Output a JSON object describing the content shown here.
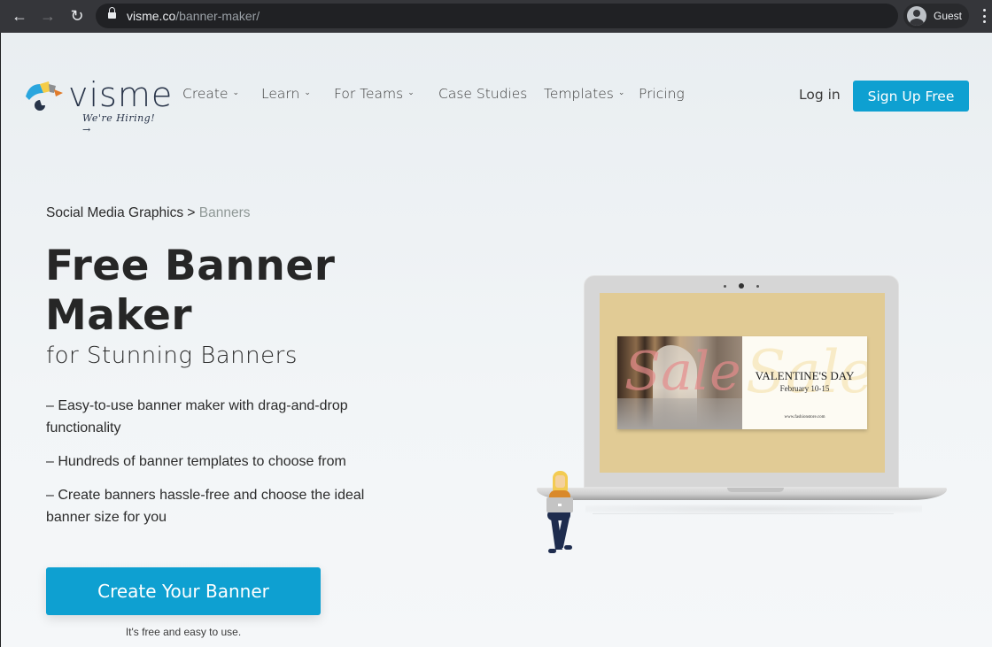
{
  "browser": {
    "url_host": "visme.co",
    "url_path": "/banner-maker/",
    "profile_name": "Guest",
    "icons": [
      "back-arrow-icon",
      "forward-arrow-icon",
      "reload-icon",
      "lock-icon",
      "profile-avatar-icon",
      "kebab-menu-icon"
    ]
  },
  "header": {
    "logo_text": "visme",
    "hiring_text": "We're Hiring! →",
    "nav": [
      {
        "label": "Create",
        "has_dropdown": true
      },
      {
        "label": "Learn",
        "has_dropdown": true
      },
      {
        "label": "For Teams",
        "has_dropdown": true
      },
      {
        "label": "Case Studies",
        "has_dropdown": false
      },
      {
        "label": "Templates",
        "has_dropdown": true
      },
      {
        "label": "Pricing",
        "has_dropdown": false
      }
    ],
    "chevron": "⌄",
    "login_label": "Log in",
    "signup_label": "Sign Up Free"
  },
  "hero": {
    "breadcrumb": {
      "parent": "Social Media Graphics",
      "separator": " > ",
      "current": "Banners"
    },
    "title": "Free Banner Maker",
    "subtitle": "for Stunning Banners",
    "features": [
      "– Easy-to-use banner maker with drag-and-drop functionality",
      "– Hundreds of banner templates to choose from",
      "– Create banners hassle-free and choose the ideal banner size for you"
    ],
    "cta_label": "Create Your Banner",
    "cta_note": "It's free and easy to use."
  },
  "illustration": {
    "banner_script_left": "Sale",
    "banner_script_right": "Sale",
    "banner_title": "VALENTINE'S DAY",
    "banner_date": "February 10-15",
    "banner_url": "www.fashionstore.com"
  },
  "colors": {
    "accent": "#0ea0d1",
    "heading": "#262626",
    "breadcrumb_current": "#8f9896",
    "chrome_bg": "#35363a",
    "screen_bg": "#e1cb95"
  }
}
